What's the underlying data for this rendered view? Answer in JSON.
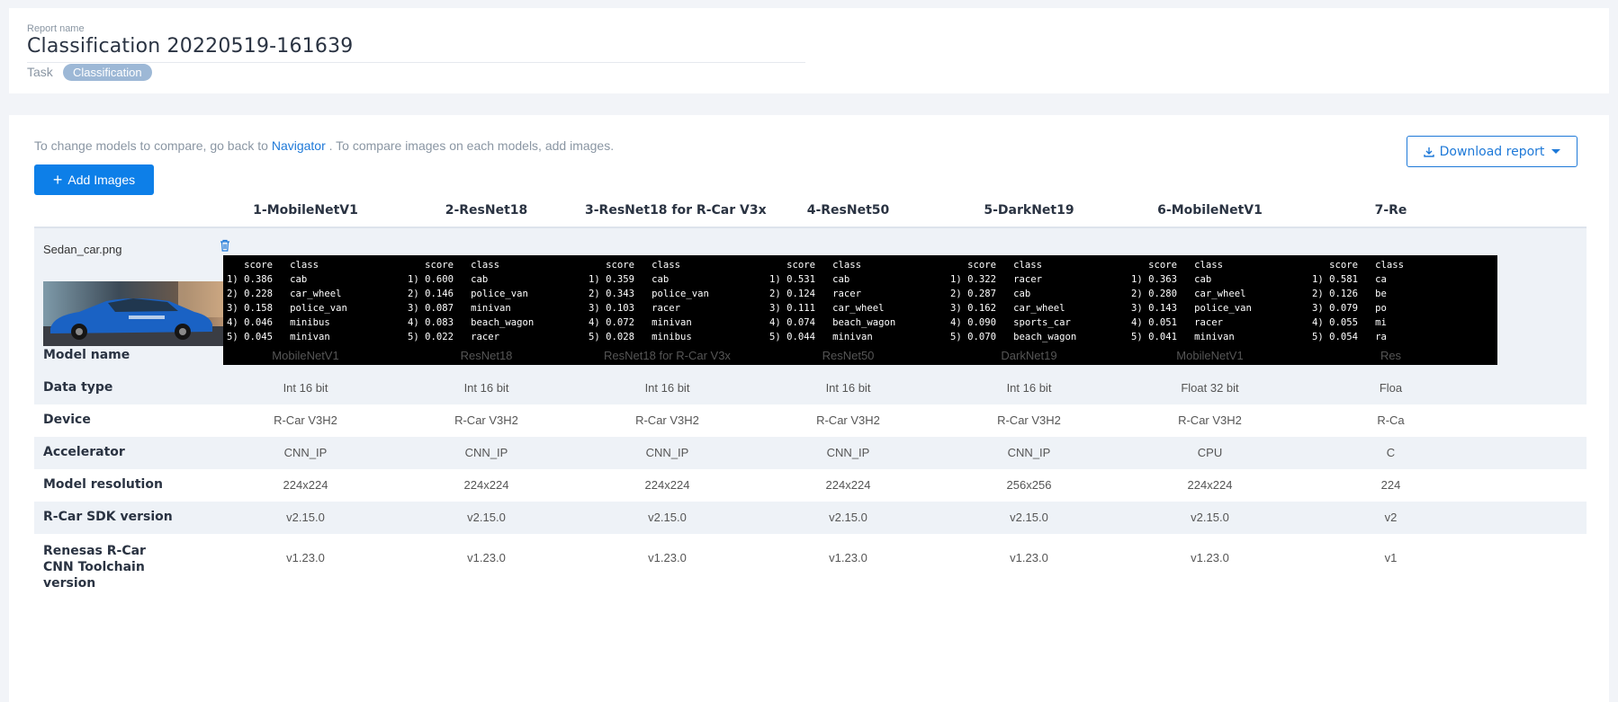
{
  "header": {
    "report_label": "Report name",
    "report_name": "Classification 20220519-161639",
    "task_label": "Task",
    "task_value": "Classification"
  },
  "toolbar": {
    "hint_before": "To change models to compare, go back to ",
    "hint_link": "Navigator",
    "hint_after": " . To compare images on each models, add images.",
    "add_images_label": "Add Images",
    "download_label": "Download report"
  },
  "image": {
    "file_name": "Sedan_car.png"
  },
  "columns": [
    {
      "title": "1-MobileNetV1",
      "results": [
        [
          "0.386",
          "cab"
        ],
        [
          "0.228",
          "car_wheel"
        ],
        [
          "0.158",
          "police_van"
        ],
        [
          "0.046",
          "minibus"
        ],
        [
          "0.045",
          "minivan"
        ]
      ],
      "attrs": [
        "MobileNetV1",
        "Int 16 bit",
        "R-Car V3H2",
        "CNN_IP",
        "224x224",
        "v2.15.0",
        "v1.23.0"
      ]
    },
    {
      "title": "2-ResNet18",
      "results": [
        [
          "0.600",
          "cab"
        ],
        [
          "0.146",
          "police_van"
        ],
        [
          "0.087",
          "minivan"
        ],
        [
          "0.083",
          "beach_wagon"
        ],
        [
          "0.022",
          "racer"
        ]
      ],
      "attrs": [
        "ResNet18",
        "Int 16 bit",
        "R-Car V3H2",
        "CNN_IP",
        "224x224",
        "v2.15.0",
        "v1.23.0"
      ]
    },
    {
      "title": "3-ResNet18 for R-Car V3x",
      "results": [
        [
          "0.359",
          "cab"
        ],
        [
          "0.343",
          "police_van"
        ],
        [
          "0.103",
          "racer"
        ],
        [
          "0.072",
          "minivan"
        ],
        [
          "0.028",
          "minibus"
        ]
      ],
      "attrs": [
        "ResNet18 for R-Car V3x",
        "Int 16 bit",
        "R-Car V3H2",
        "CNN_IP",
        "224x224",
        "v2.15.0",
        "v1.23.0"
      ]
    },
    {
      "title": "4-ResNet50",
      "results": [
        [
          "0.531",
          "cab"
        ],
        [
          "0.124",
          "racer"
        ],
        [
          "0.111",
          "car_wheel"
        ],
        [
          "0.074",
          "beach_wagon"
        ],
        [
          "0.044",
          "minivan"
        ]
      ],
      "attrs": [
        "ResNet50",
        "Int 16 bit",
        "R-Car V3H2",
        "CNN_IP",
        "224x224",
        "v2.15.0",
        "v1.23.0"
      ]
    },
    {
      "title": "5-DarkNet19",
      "results": [
        [
          "0.322",
          "racer"
        ],
        [
          "0.287",
          "cab"
        ],
        [
          "0.162",
          "car_wheel"
        ],
        [
          "0.090",
          "sports_car"
        ],
        [
          "0.070",
          "beach_wagon"
        ]
      ],
      "attrs": [
        "DarkNet19",
        "Int 16 bit",
        "R-Car V3H2",
        "CNN_IP",
        "256x256",
        "v2.15.0",
        "v1.23.0"
      ]
    },
    {
      "title": "6-MobileNetV1",
      "results": [
        [
          "0.363",
          "cab"
        ],
        [
          "0.280",
          "car_wheel"
        ],
        [
          "0.143",
          "police_van"
        ],
        [
          "0.051",
          "racer"
        ],
        [
          "0.041",
          "minivan"
        ]
      ],
      "attrs": [
        "MobileNetV1",
        "Float 32 bit",
        "R-Car V3H2",
        "CPU",
        "224x224",
        "v2.15.0",
        "v1.23.0"
      ]
    },
    {
      "title": "7-Re",
      "results": [
        [
          "0.581",
          "ca"
        ],
        [
          "0.126",
          "be"
        ],
        [
          "0.079",
          "po"
        ],
        [
          "0.055",
          "mi"
        ],
        [
          "0.054",
          "ra"
        ]
      ],
      "attrs": [
        "Res",
        "Floa",
        "R-Ca",
        "C",
        "224",
        "v2",
        "v1"
      ]
    }
  ],
  "row_labels": [
    "Model name",
    "Data type",
    "Device",
    "Accelerator",
    "Model resolution",
    "R-Car SDK version",
    "Renesas R-Car CNN Toolchain version"
  ],
  "score_header": "score",
  "class_header": "class"
}
